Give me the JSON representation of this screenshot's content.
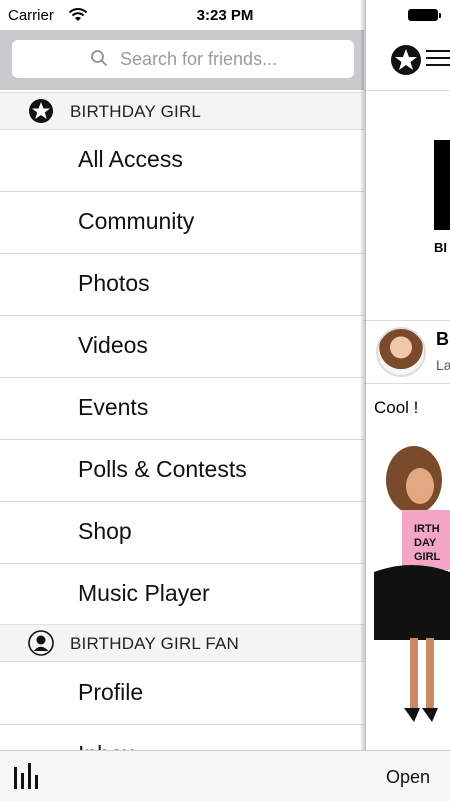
{
  "status": {
    "carrier": "Carrier",
    "time": "3:23 PM"
  },
  "search": {
    "placeholder": "Search for friends..."
  },
  "sections": [
    {
      "title": "BIRTHDAY GIRL",
      "icon": "star-logo-icon",
      "items": [
        "All Access",
        "Community",
        "Photos",
        "Videos",
        "Events",
        "Polls & Contests",
        "Shop",
        "Music Player"
      ]
    },
    {
      "title": "BIRTHDAY GIRL FAN",
      "icon": "user-avatar-icon",
      "items": [
        "Profile",
        "Inbox"
      ]
    }
  ],
  "content": {
    "banner_text": "BI",
    "post": {
      "name": "B",
      "subtitle": "La",
      "text": "Cool !"
    }
  },
  "toolbar": {
    "open_label": "Open",
    "left_icon": "equalizer-icon"
  }
}
